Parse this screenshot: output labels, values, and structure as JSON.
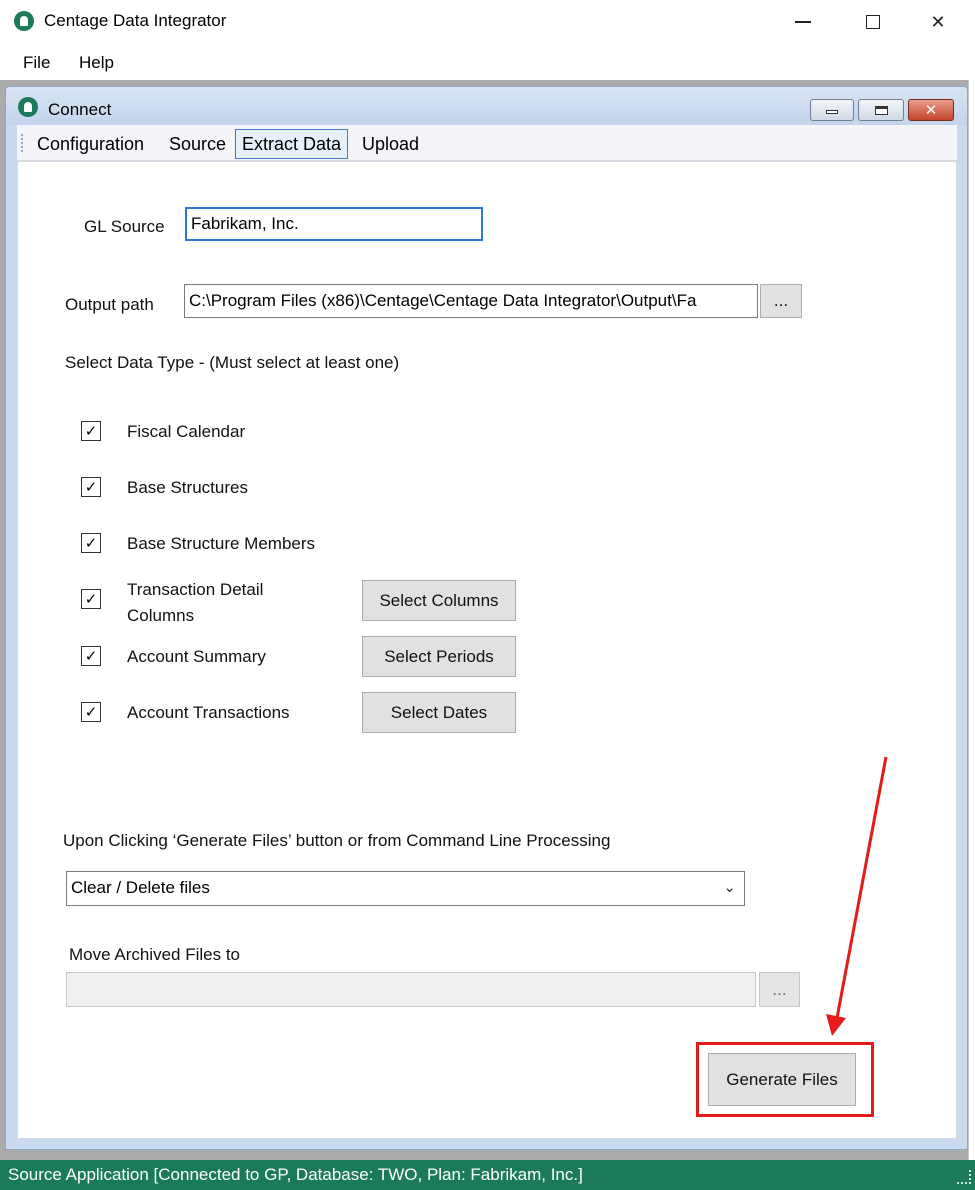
{
  "window": {
    "title": "Centage Data Integrator",
    "minimize_icon": "minimize-icon",
    "maximize_icon": "maximize-icon",
    "close_icon": "close-icon",
    "close_glyph": "✕"
  },
  "menu": {
    "file": "File",
    "help": "Help"
  },
  "child": {
    "title": "Connect",
    "close_glyph": "✕"
  },
  "tabs": {
    "configuration": "Configuration",
    "source": "Source",
    "extract": "Extract Data",
    "upload": "Upload"
  },
  "form": {
    "gl_source_label": "GL Source",
    "gl_source_value": "Fabrikam, Inc.",
    "output_path_label": "Output path",
    "output_path_value": "C:\\Program Files (x86)\\Centage\\Centage Data Integrator\\Output\\Fa",
    "browse_label": "...",
    "data_type_heading": "Select Data Type - (Must select at least one)",
    "check_glyph": "✓",
    "data_types": [
      {
        "label": "Fiscal Calendar",
        "checked": true
      },
      {
        "label": "Base Structures",
        "checked": true
      },
      {
        "label": "Base Structure Members",
        "checked": true
      },
      {
        "label": "Transaction Detail Columns",
        "checked": true
      },
      {
        "label": "Account Summary",
        "checked": true
      },
      {
        "label": "Account Transactions",
        "checked": true
      }
    ],
    "select_columns": "Select Columns",
    "select_periods": "Select Periods",
    "select_dates": "Select Dates",
    "processing_label": "Upon Clicking ‘Generate Files’ button or from Command Line Processing",
    "processing_option": "Clear / Delete files",
    "archive_label": "Move Archived Files to",
    "archive_value": "",
    "archive_browse": "...",
    "generate_button": "Generate Files"
  },
  "annotation_color": "#e51b1b",
  "status": {
    "text": "Source Application [Connected to GP, Database: TWO, Plan: Fabrikam, Inc.]",
    "color": "#1b7a5a"
  }
}
